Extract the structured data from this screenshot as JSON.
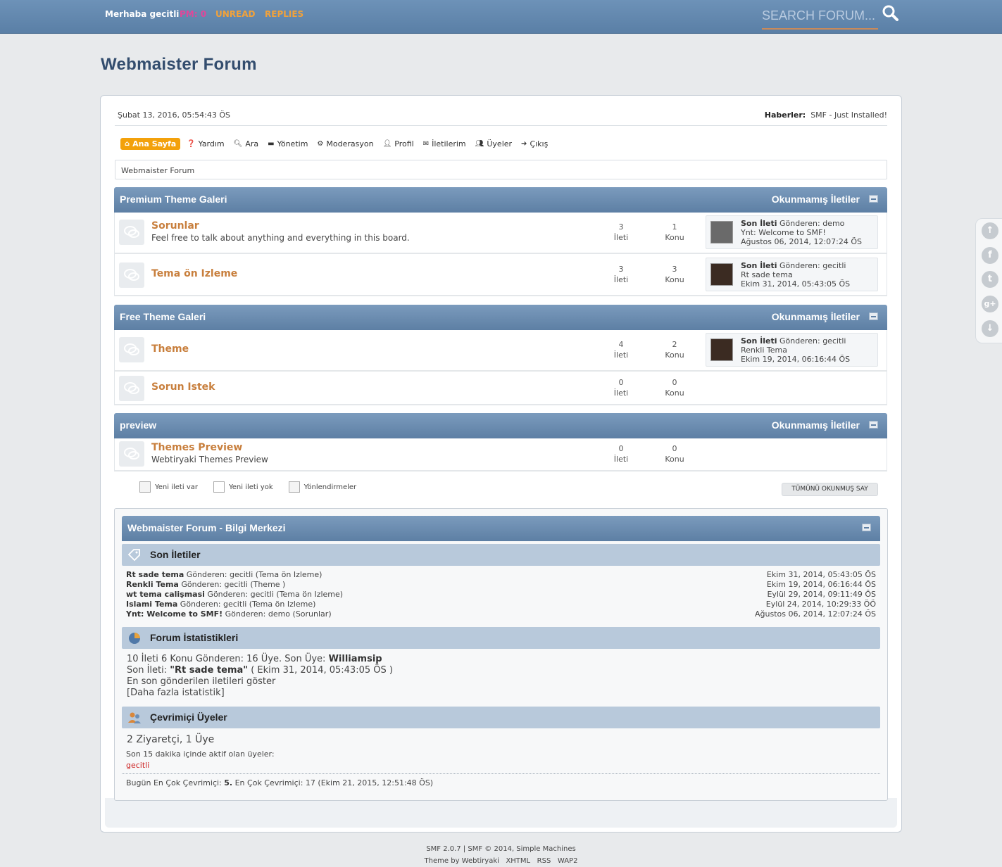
{
  "topbar": {
    "greeting": "Merhaba gecitli",
    "pm": "PM: 0",
    "unread": "UNREAD",
    "replies": "REPLIES",
    "search_placeholder": "SEARCH FORUM..."
  },
  "site_title": "Webmaister Forum",
  "date": "Şubat 13, 2016, 05:54:43 ÖS",
  "news": {
    "label": "Haberler:",
    "text": "SMF - Just Installed!"
  },
  "menu": {
    "home": "Ana Sayfa",
    "help": "Yardım",
    "search": "Ara",
    "admin": "Yönetim",
    "moderation": "Moderasyon",
    "profile": "Profil",
    "messages": "İletilerim",
    "members": "Üyeler",
    "logout": "Çıkış"
  },
  "breadcrumb": "Webmaister Forum",
  "unread_label": "Okunmamış İletiler",
  "categories": [
    {
      "title": "Premium Theme Galeri",
      "boards": [
        {
          "name": "Sorunlar",
          "desc": "Feel free to talk about anything and everything in this board.",
          "posts": "3",
          "posts_label": "İleti",
          "topics": "1",
          "topics_label": "Konu",
          "last": {
            "label": "Son İleti",
            "by": "Gönderen: demo",
            "subject": "Ynt: Welcome to SMF!",
            "date": "Ağustos 06, 2014, 12:07:24 ÖS"
          }
        },
        {
          "name": "Tema ön Izleme",
          "desc": "",
          "posts": "3",
          "posts_label": "İleti",
          "topics": "3",
          "topics_label": "Konu",
          "last": {
            "label": "Son İleti",
            "by": "Gönderen: gecitli",
            "subject": "Rt sade tema",
            "date": "Ekim 31, 2014, 05:43:05 ÖS"
          }
        }
      ]
    },
    {
      "title": "Free Theme Galeri",
      "boards": [
        {
          "name": "Theme",
          "desc": "",
          "posts": "4",
          "posts_label": "İleti",
          "topics": "2",
          "topics_label": "Konu",
          "last": {
            "label": "Son İleti",
            "by": "Gönderen: gecitli",
            "subject": "Renkli Tema",
            "date": "Ekim 19, 2014, 06:16:44 ÖS"
          }
        },
        {
          "name": "Sorun Istek",
          "desc": "",
          "posts": "0",
          "posts_label": "İleti",
          "topics": "0",
          "topics_label": "Konu"
        }
      ]
    },
    {
      "title": "preview",
      "boards": [
        {
          "name": "Themes Preview",
          "desc": "Webtiryaki Themes Preview",
          "posts": "0",
          "posts_label": "İleti",
          "topics": "0",
          "topics_label": "Konu"
        }
      ]
    }
  ],
  "legend": {
    "new": "Yeni ileti var",
    "none": "Yeni ileti yok",
    "redirect": "Yönlendirmeler"
  },
  "mark_read": "TÜMÜNÜ OKUNMUŞ SAY",
  "info": {
    "title": "Webmaister Forum - Bilgi Merkezi",
    "recent_title": "Son İletiler",
    "recent": [
      {
        "subject": "Rt sade tema",
        "by": "Gönderen: gecitli (Tema ön Izleme)",
        "date": "Ekim 31, 2014, 05:43:05 ÖS"
      },
      {
        "subject": "Renkli Tema",
        "by": "Gönderen: gecitli (Theme )",
        "date": "Ekim 19, 2014, 06:16:44 ÖS"
      },
      {
        "subject": "wt tema calişmasi",
        "by": "Gönderen: gecitli (Tema ön Izleme)",
        "date": "Eylül 29, 2014, 09:11:49 ÖS"
      },
      {
        "subject": "Islami Tema",
        "by": "Gönderen: gecitli (Tema ön Izleme)",
        "date": "Eylül 24, 2014, 10:29:33 ÖÖ"
      },
      {
        "subject": "Ynt: Welcome to SMF!",
        "by": "Gönderen: demo (Sorunlar)",
        "date": "Ağustos 06, 2014, 12:07:24 ÖS"
      }
    ],
    "stats_title": "Forum İstatistikleri",
    "stats_line1": "10 İleti 6 Konu Gönderen: 16 Üye. Son Üye:",
    "stats_latest_member": "Williamsip",
    "stats_last_post_label": "Son İleti:",
    "stats_last_post": "\"Rt sade tema\"",
    "stats_last_post_date": "( Ekim 31, 2014, 05:43:05 ÖS )",
    "stats_show_recent": "En son gönderilen iletileri göster",
    "stats_more": "[Daha fazla istatistik]",
    "online_title": "Çevrimiçi Üyeler",
    "online_count": "2 Ziyaretçi, 1 Üye",
    "online_recent": "Son 15 dakika içinde aktif olan üyeler:",
    "online_user": "gecitli",
    "today_label": "Bugün En Çok Çevrimiçi:",
    "today_value": "5.",
    "today_rest": "En Çok Çevrimiçi: 17 (Ekim 21, 2015, 12:51:48 ÖS)"
  },
  "footer": {
    "line1": "SMF 2.0.7 | SMF © 2014, Simple Machines",
    "theme_by": "Theme by Webtiryaki",
    "xhtml": "XHTML",
    "rss": "RSS",
    "wap2": "WAP2"
  },
  "colors": {
    "accent": "#f3a10b",
    "board_link": "#c87f3d",
    "header_blue": "#5d7fa4"
  }
}
